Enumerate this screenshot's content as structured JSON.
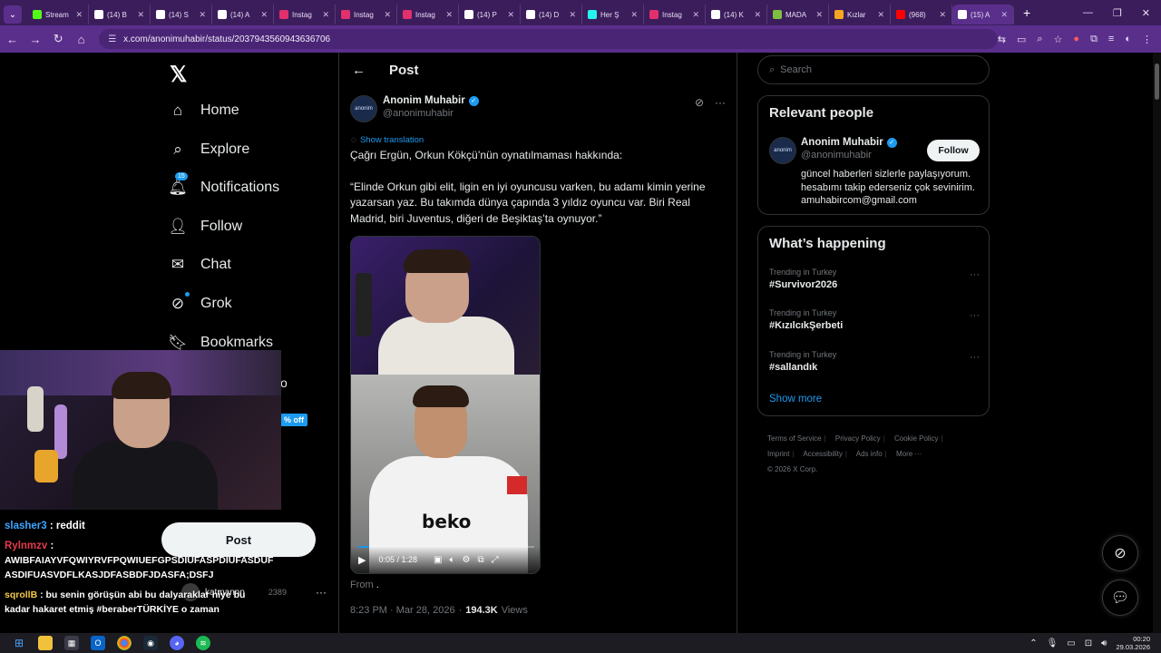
{
  "browser": {
    "tabs": [
      {
        "label": "Stream",
        "color": "#53fc18"
      },
      {
        "label": "(14) B",
        "color": "#ffffff"
      },
      {
        "label": "(14) S",
        "color": "#ffffff"
      },
      {
        "label": "(14) A",
        "color": "#ffffff"
      },
      {
        "label": "Instag",
        "color": "#e1306c"
      },
      {
        "label": "Instag",
        "color": "#e1306c"
      },
      {
        "label": "Instag",
        "color": "#e1306c"
      },
      {
        "label": "(14) P",
        "color": "#ffffff"
      },
      {
        "label": "(14) D",
        "color": "#ffffff"
      },
      {
        "label": "Her Ş",
        "color": "#25f4ee"
      },
      {
        "label": "Instag",
        "color": "#e1306c"
      },
      {
        "label": "(14) K",
        "color": "#ffffff"
      },
      {
        "label": "MADA",
        "color": "#7fbf3f"
      },
      {
        "label": "Kızlar",
        "color": "#f5a623"
      },
      {
        "label": "(968)",
        "color": "#ff0000"
      },
      {
        "label": "(15) A",
        "color": "#ffffff"
      }
    ],
    "url": "x.com/anonimuhabir/status/2037943560943636706"
  },
  "nav": {
    "items": [
      {
        "label": "Home",
        "icon": "home-icon"
      },
      {
        "label": "Explore",
        "icon": "search-icon"
      },
      {
        "label": "Notifications",
        "icon": "bell-icon",
        "badge": "15"
      },
      {
        "label": "Follow",
        "icon": "add-user-icon"
      },
      {
        "label": "Chat",
        "icon": "mail-icon"
      },
      {
        "label": "Grok",
        "icon": "grok-icon"
      },
      {
        "label": "Bookmarks",
        "icon": "bookmark-icon"
      }
    ],
    "partial_label": "o",
    "premium_badge": "% off",
    "post_button": "Post",
    "account_name": "katmannn",
    "account_handle": "2389"
  },
  "chat": [
    {
      "user": "slasher3",
      "text": ": reddit"
    },
    {
      "user": "Rylnmzv",
      "text": ":"
    },
    {
      "user": "",
      "text": "AWIBFAIAYVFQWIYRVFPQWIUEFGPSDIUFASPDIUFASDUF"
    },
    {
      "user": "",
      "text": "ASDIFUASVDFLKASJDFASBDFJDASFA;DSFJ"
    },
    {
      "user": "sqrollB",
      "text": ": bu senin görüşün abi bu dalyaraklar niye bu"
    },
    {
      "user": "",
      "text": "kadar hakaret etmiş #beraberTÜRKİYE o zaman"
    }
  ],
  "post": {
    "title": "Post",
    "author_name": "Anonim Muhabir",
    "author_handle": "@anonimuhabir",
    "avatar_text": "anonim",
    "show_translation": "Show translation",
    "text_line1": "Çağrı Ergün, Orkun Kökçü’nün oynatılmaması hakkında:",
    "text_line2": "“Elinde Orkun gibi elit, ligin en iyi oyuncusu varken, bu adamı kimin yerine yazarsan yaz. Bu takımda dünya çapında 3 yıldız oyuncu var. Biri Real Madrid, biri Juventus, diğeri de Beşiktaş’ta oynuyor.”",
    "video_time": "0:05 / 1:28",
    "video_progress": 0.06,
    "jersey_text": "beko",
    "from_label": "From",
    "from_target": ".",
    "timestamp": "8:23 PM · Mar 28, 2026",
    "views_count": "194.3K",
    "views_label": "Views"
  },
  "right": {
    "search_placeholder": "Search",
    "relevant_title": "Relevant people",
    "relevant_name": "Anonim Muhabir",
    "relevant_handle": "@anonimuhabir",
    "relevant_bio": "güncel haberleri sizlerle paylaşıyorum. hesabımı takip ederseniz çok sevinirim. amuhabircom@gmail.com",
    "follow_label": "Follow",
    "happening_title": "What’s happening",
    "trends": [
      {
        "context": "Trending in Turkey",
        "name": "#Survivor2026"
      },
      {
        "context": "Trending in Turkey",
        "name": "#KızılcıkŞerbeti"
      },
      {
        "context": "Trending in Turkey",
        "name": "#sallandık"
      }
    ],
    "show_more": "Show more",
    "footer": [
      "Terms of Service",
      "Privacy Policy",
      "Cookie Policy",
      "Imprint",
      "Accessibility",
      "Ads info",
      "More ···",
      "© 2026 X Corp."
    ]
  },
  "taskbar": {
    "time": "00:20",
    "date": "29.03.2026"
  }
}
